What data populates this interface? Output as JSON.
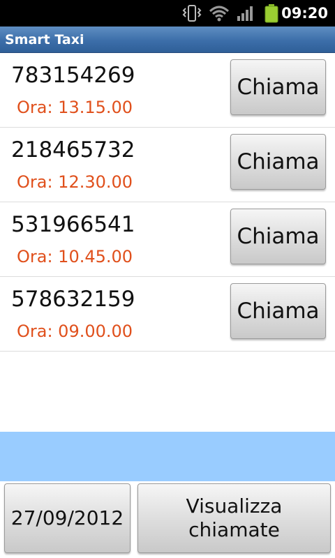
{
  "status_bar": {
    "time": "09:20",
    "icons": [
      "vibrate-icon",
      "wifi-icon",
      "signal-icon",
      "battery-icon"
    ],
    "battery_color": "#9acd32"
  },
  "app": {
    "title": "Smart Taxi",
    "accent_color": "#3c6ea9"
  },
  "calls": [
    {
      "number": "783154269",
      "time": "Ora: 13.15.00",
      "button": "Chiama"
    },
    {
      "number": "218465732",
      "time": "Ora: 12.30.00",
      "button": "Chiama"
    },
    {
      "number": "531966541",
      "time": "Ora: 10.45.00",
      "button": "Chiama"
    },
    {
      "number": "578632159",
      "time": "Ora: 09.00.00",
      "button": "Chiama"
    }
  ],
  "time_color": "#e0501c",
  "band_color": "#99ccff",
  "bottom": {
    "date_button": "27/09/2012",
    "view_button_line1": "Visualizza",
    "view_button_line2": "chiamate"
  }
}
